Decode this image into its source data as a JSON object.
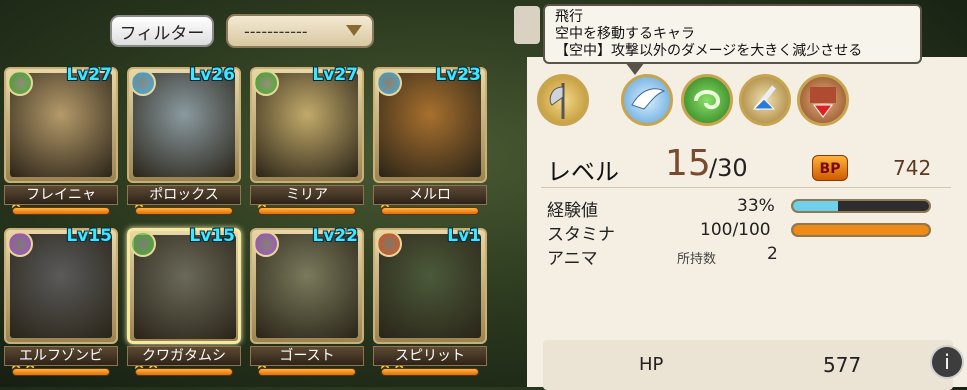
{
  "filter": {
    "label": "フィルター"
  },
  "sort_select": {
    "value": "-----------"
  },
  "units": [
    {
      "name": "フレイニャ",
      "level": "Lv27",
      "stars": "★",
      "element": "wind",
      "bg": "#b59a6a"
    },
    {
      "name": "ポロックス",
      "level": "Lv26",
      "stars": "★",
      "element": "water",
      "bg": "#8a9aa0"
    },
    {
      "name": "ミリア",
      "level": "Lv27",
      "stars": "★",
      "element": "wind",
      "bg": "#c2aa6a"
    },
    {
      "name": "メルロ",
      "level": "Lv23",
      "stars": "★",
      "element": "water",
      "bg": "#a8702e"
    },
    {
      "name": "エルフゾンビ",
      "level": "Lv15",
      "stars": "★★",
      "element": "dark",
      "bg": "#5a5a5a"
    },
    {
      "name": "クワガタムシ",
      "level": "Lv15",
      "stars": "★★",
      "element": "wind",
      "bg": "#6b6a5a"
    },
    {
      "name": "ゴースト",
      "level": "Lv22",
      "stars": "★",
      "element": "dark",
      "bg": "#7a7a5c"
    },
    {
      "name": "スピリット",
      "level": "Lv1",
      "stars": "★★",
      "element": "fire",
      "bg": "#4b5a3a"
    }
  ],
  "tooltip": {
    "line1": "飛行",
    "line2": "空中を移動するキャラ",
    "line3": "【空中】攻撃以外のダメージを大きく減少させる"
  },
  "skills": [
    "axe-class-icon",
    "flying-wing-icon",
    "wind-element-icon",
    "attack-up-icon",
    "defense-down-icon"
  ],
  "detail": {
    "level_label": "レベル",
    "level_value": "15",
    "level_max": "/30",
    "bp_label": "BP",
    "bp_value": "742",
    "exp_label": "経験値",
    "exp_value": "33%",
    "exp_fraction": 0.33,
    "stamina_label": "スタミナ",
    "stamina_value": "100/100",
    "stamina_fraction": 1.0,
    "anima_label": "アニマ",
    "anima_owned_label": "所持数",
    "anima_value": "2",
    "hp_label": "HP",
    "hp_value": "577",
    "info_badge": "i"
  },
  "colors": {
    "level_cyan": "#3ee6ff",
    "exp_bar": "#6fd0ea",
    "stamina_bar": "#f08a16",
    "wind": "#3fae2a",
    "water": "#3aa8d8",
    "dark": "#a24fc4",
    "fire": "#e0541b"
  }
}
